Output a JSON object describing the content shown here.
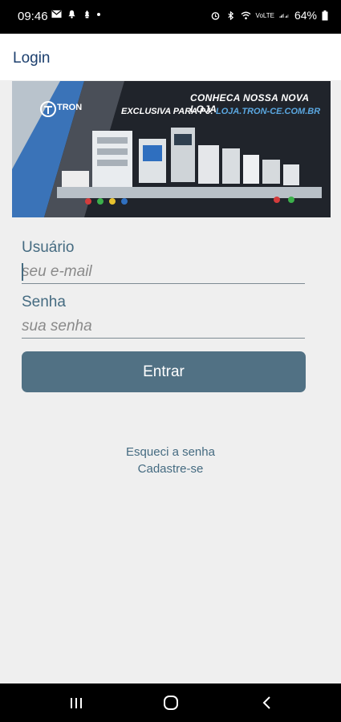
{
  "status_bar": {
    "time": "09:46",
    "battery": "64%",
    "network": "VoLTE",
    "icons": [
      "mail-icon",
      "bell-icon",
      "notification-icon",
      "dot-icon",
      "alarm-icon",
      "bluetooth-icon",
      "wifi-icon",
      "signal-icon",
      "battery-icon"
    ]
  },
  "app_bar": {
    "title": "Login"
  },
  "banner": {
    "logo": "TRON",
    "headline": "CONHECA NOSSA NOVA LOJA",
    "subline": "EXCLUSIVA PARA PJ:",
    "url": "LOJA.TRON-CE.COM.BR"
  },
  "form": {
    "user_label": "Usuário",
    "user_placeholder": "seu e-mail",
    "user_value": "",
    "password_label": "Senha",
    "password_placeholder": "sua senha",
    "password_value": "",
    "submit_label": "Entrar"
  },
  "links": {
    "forgot_password": "Esqueci a senha",
    "register": "Cadastre-se"
  },
  "nav_bar": {
    "icons": [
      "recent-apps-icon",
      "home-icon",
      "back-icon"
    ]
  },
  "colors": {
    "accent": "#517184",
    "label": "#456b81",
    "title": "#1c3f6e",
    "background": "#efefef"
  }
}
